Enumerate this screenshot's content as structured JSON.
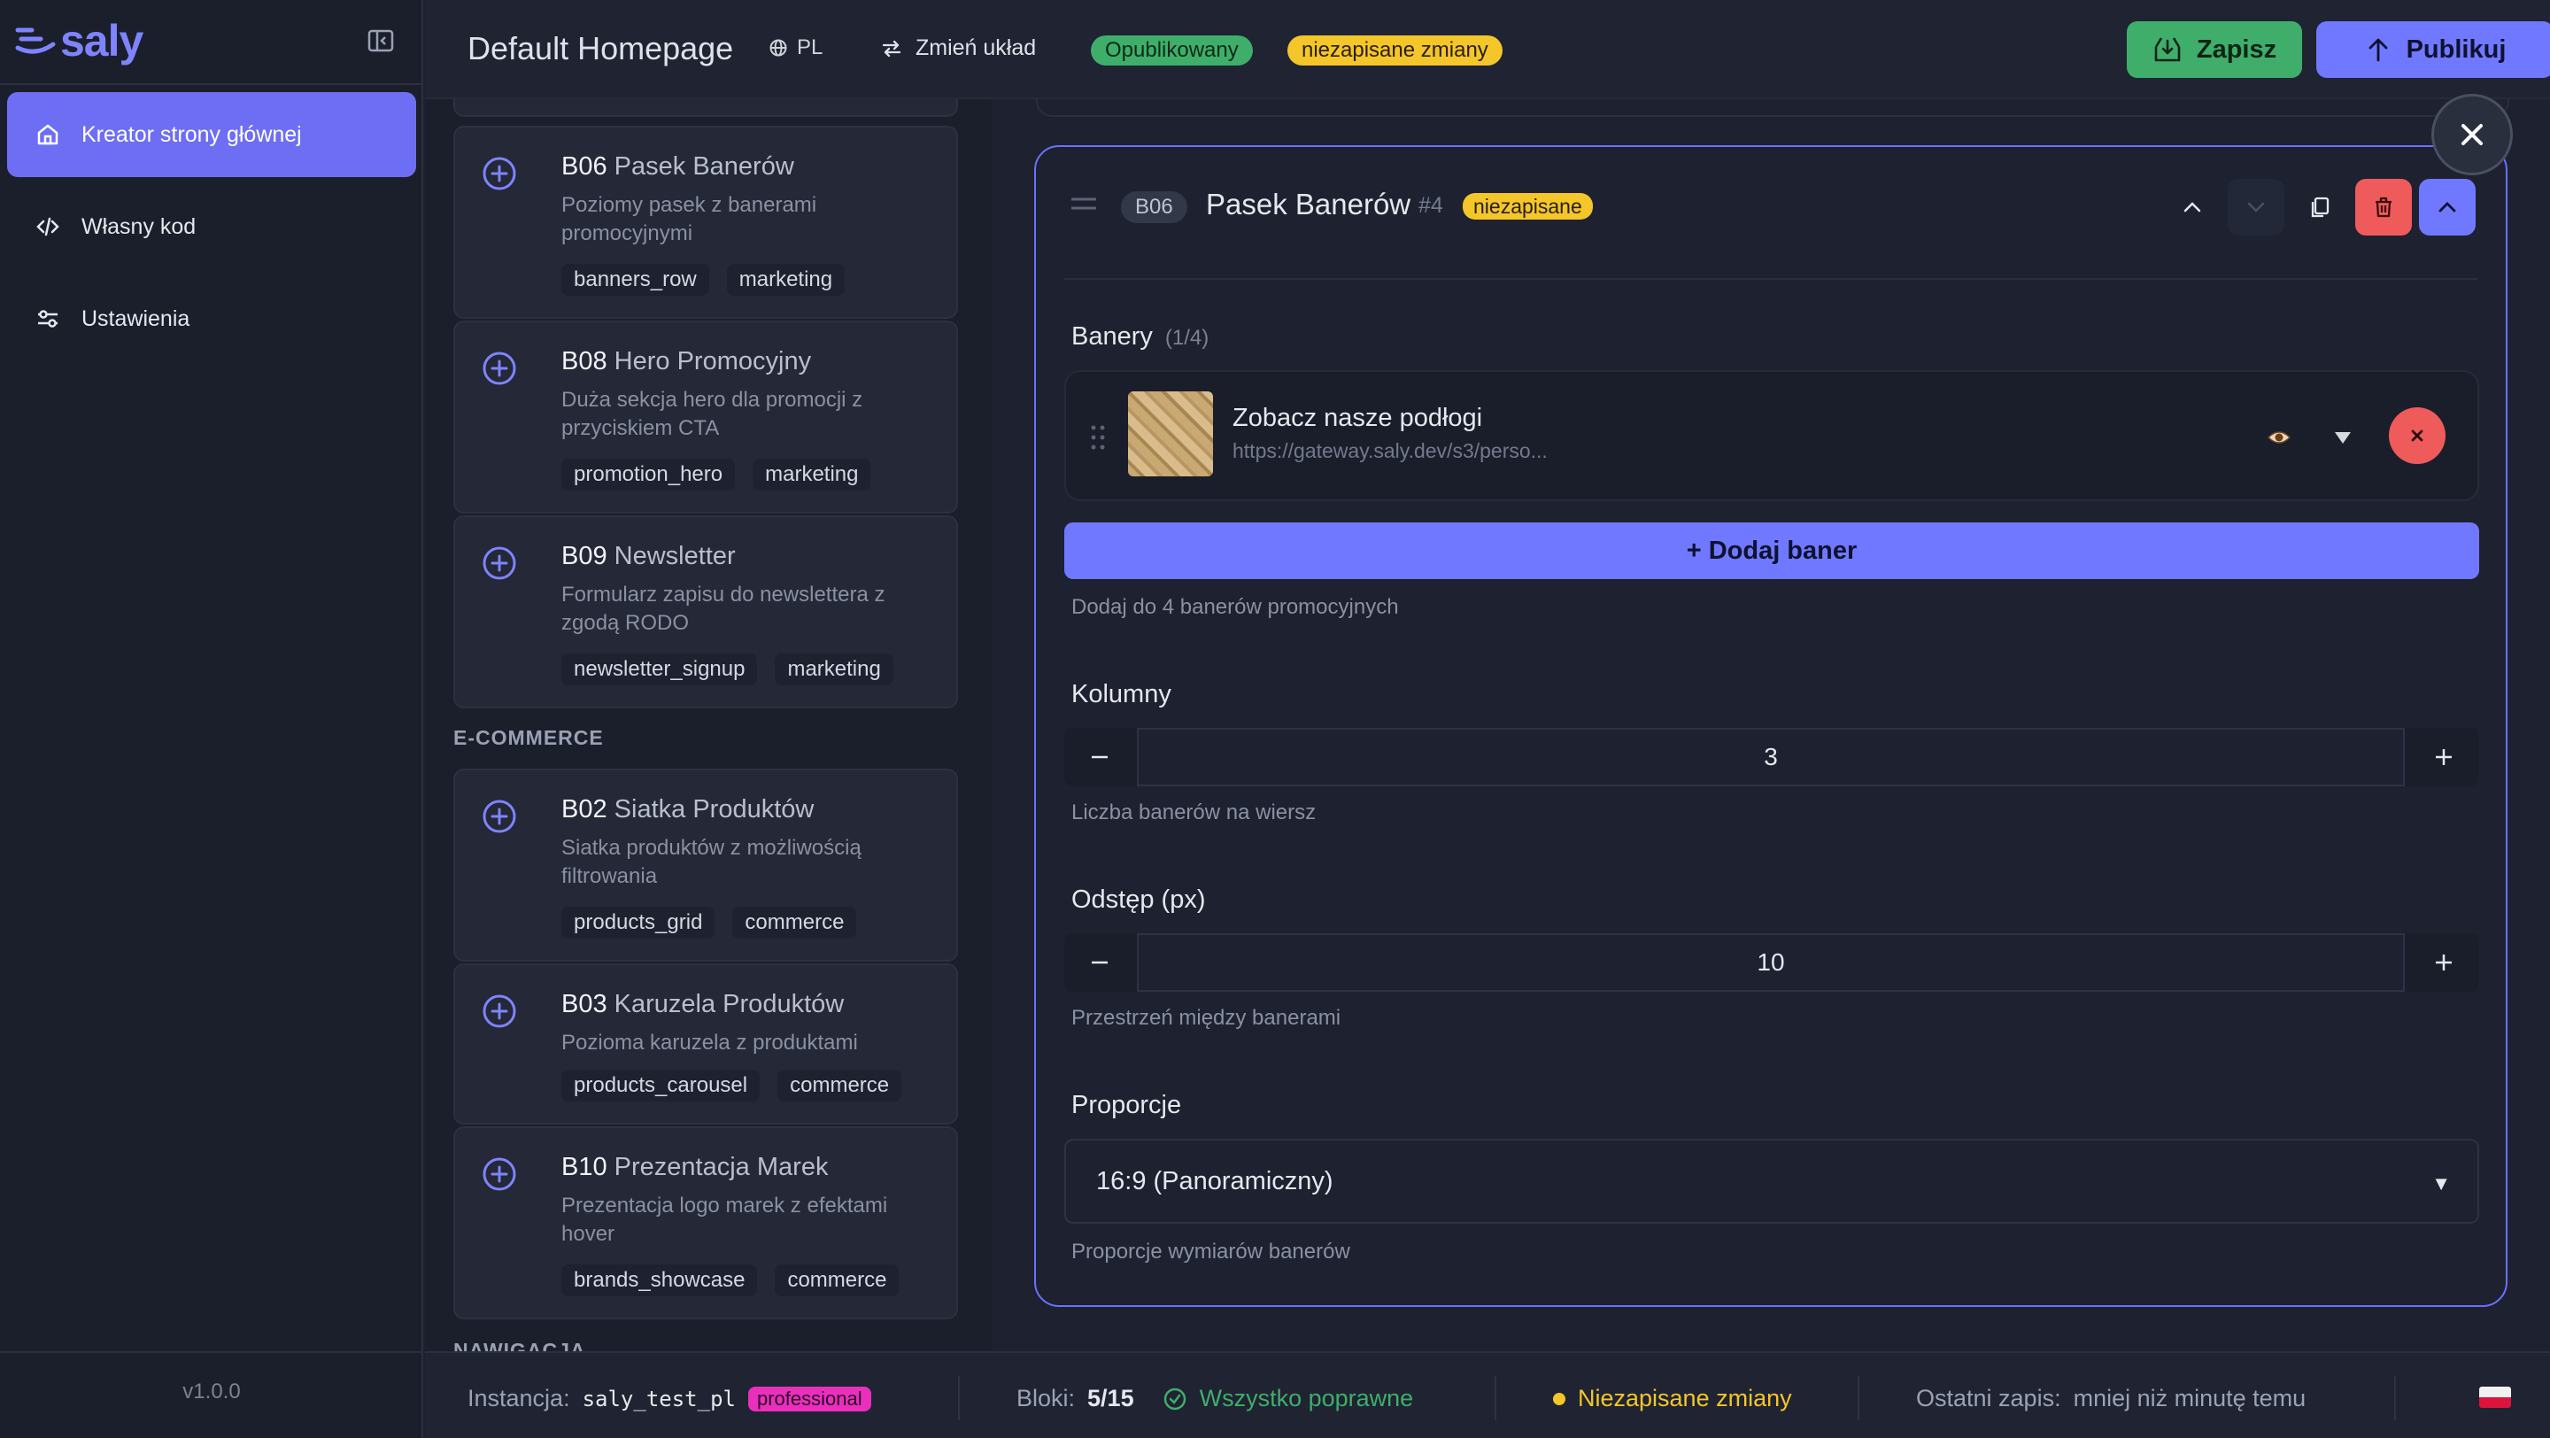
{
  "app": {
    "brand": "saly",
    "version": "v1.0.0",
    "nav": [
      {
        "label": "Kreator strony głównej",
        "icon": "home-icon",
        "active": true
      },
      {
        "label": "Własny kod",
        "icon": "code-icon",
        "active": false
      },
      {
        "label": "Ustawienia",
        "icon": "settings-sliders-icon",
        "active": false
      }
    ]
  },
  "header": {
    "title": "Default Homepage",
    "lang": "PL",
    "change_layout": "Zmień układ",
    "status_published": "Opublikowany",
    "status_unsaved": "niezapisane zmiany",
    "save_label": "Zapisz",
    "publish_label": "Publikuj"
  },
  "blocks": {
    "marketing": [
      {
        "code": "B06",
        "name": "Pasek Banerów",
        "desc": "Poziomy pasek z banerami promocyjnymi",
        "tags": [
          "banners_row",
          "marketing"
        ]
      },
      {
        "code": "B08",
        "name": "Hero Promocyjny",
        "desc": "Duża sekcja hero dla promocji z przyciskiem CTA",
        "tags": [
          "promotion_hero",
          "marketing"
        ]
      },
      {
        "code": "B09",
        "name": "Newsletter",
        "desc": "Formularz zapisu do newslettera z zgodą RODO",
        "tags": [
          "newsletter_signup",
          "marketing"
        ]
      }
    ],
    "ecommerce_label": "E-COMMERCE",
    "ecommerce": [
      {
        "code": "B02",
        "name": "Siatka Produktów",
        "desc": "Siatka produktów z możliwością filtrowania",
        "tags": [
          "products_grid",
          "commerce"
        ]
      },
      {
        "code": "B03",
        "name": "Karuzela Produktów",
        "desc": "Pozioma karuzela z produktami",
        "tags": [
          "products_carousel",
          "commerce"
        ]
      },
      {
        "code": "B10",
        "name": "Prezentacja Marek",
        "desc": "Prezentacja logo marek z efektami hover",
        "tags": [
          "brands_showcase",
          "commerce"
        ]
      }
    ],
    "next_section_label": "NAWIGACJA"
  },
  "editor": {
    "code": "B06",
    "title": "Pasek Banerów",
    "index": "#4",
    "unsaved": "niezapisane",
    "banners_label": "Banery",
    "banners_count": "(1/4)",
    "banner": {
      "title": "Zobacz nasze podłogi",
      "url": "https://gateway.saly.dev/s3/perso..."
    },
    "add_banner": "+ Dodaj baner",
    "add_banner_help": "Dodaj do 4 banerów promocyjnych",
    "columns_label": "Kolumny",
    "columns_value": "3",
    "columns_help": "Liczba banerów na wiersz",
    "gap_label": "Odstęp (px)",
    "gap_value": "10",
    "gap_help": "Przestrzeń między banerami",
    "ratio_label": "Proporcje",
    "ratio_value": "16:9 (Panoramiczny)",
    "ratio_help": "Proporcje wymiarów banerów"
  },
  "status": {
    "instance_label": "Instancja:",
    "instance_value": "saly_test_pl",
    "plan": "professional",
    "blocks_label": "Bloki:",
    "blocks_value": "5/15",
    "valid": "Wszystko poprawne",
    "unsaved": "Niezapisane zmiany",
    "last_save_label": "Ostatni zapis:",
    "last_save_value": "mniej niż minutę temu"
  },
  "colors": {
    "accent": "#7078ff",
    "success": "#3fae6a",
    "warning": "#f4c62a",
    "danger": "#ef5b5b",
    "plan_badge": "#ea2fbd"
  }
}
